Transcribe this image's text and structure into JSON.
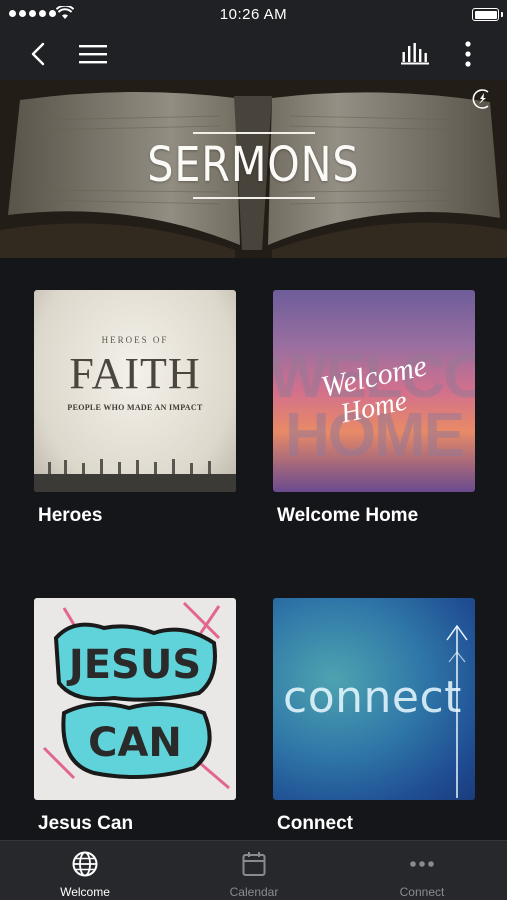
{
  "status_bar": {
    "time": "10:26 AM"
  },
  "nav": {
    "icons": [
      "back-icon",
      "menu-icon",
      "bar-chart-icon",
      "more-vertical-icon"
    ]
  },
  "hero": {
    "title": "SERMONS"
  },
  "sermons": [
    {
      "title": "Heroes",
      "art": {
        "line1": "HEROES OF",
        "line2": "FAITH",
        "line3": "PEOPLE WHO MADE AN IMPACT"
      }
    },
    {
      "title": "Welcome Home",
      "art": {
        "line1": "Welcome",
        "line2": "Home"
      }
    },
    {
      "title": "Jesus Can",
      "art": {
        "line1": "JESUS",
        "line2": "CAN"
      }
    },
    {
      "title": "Connect",
      "art": {
        "line1": "connect"
      }
    }
  ],
  "tabs": [
    {
      "label": "Welcome",
      "icon": "globe-icon",
      "active": true
    },
    {
      "label": "Calendar",
      "icon": "calendar-icon",
      "active": false
    },
    {
      "label": "Connect",
      "icon": "more-horizontal-icon",
      "active": false
    }
  ],
  "colors": {
    "background": "#151619",
    "bar": "#202124",
    "tabbar": "#27282b",
    "active_tab": "#ffffff",
    "inactive_tab": "#8a8b8f"
  }
}
